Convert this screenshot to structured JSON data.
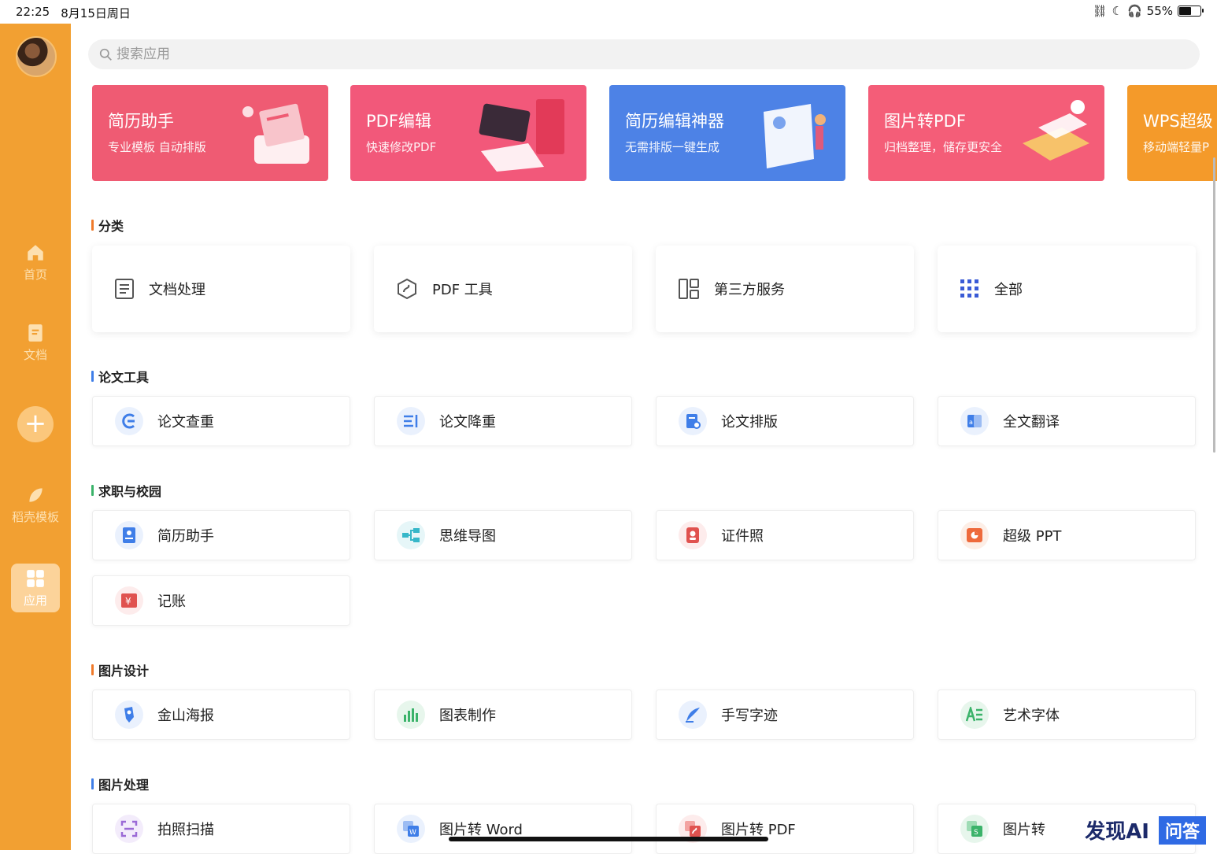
{
  "status": {
    "time": "22:25",
    "date": "8月15日周日",
    "battery": "55%",
    "battery_level": 0.55
  },
  "sidebar": {
    "items": [
      {
        "label": "首页"
      },
      {
        "label": "文档"
      },
      {
        "label": "稻壳模板"
      },
      {
        "label": "应用"
      }
    ],
    "add_label": "+"
  },
  "search": {
    "placeholder": "搜索应用"
  },
  "banners": [
    {
      "title": "简历助手",
      "subtitle": "专业模板 自动排版",
      "color": "#ef5b73"
    },
    {
      "title": "PDF编辑",
      "subtitle": "快速修改PDF",
      "color": "#f2587a"
    },
    {
      "title": "简历编辑神器",
      "subtitle": "无需排版一键生成",
      "color": "#4d82e6"
    },
    {
      "title": "图片转PDF",
      "subtitle": "归档整理，储存更安全",
      "color": "#f45d78"
    },
    {
      "title": "WPS超级",
      "subtitle": "移动端轻量P",
      "color": "#f49a2a"
    }
  ],
  "sections": {
    "category": {
      "title": "分类",
      "color": "#f07a2a",
      "items": [
        {
          "label": "文档处理"
        },
        {
          "label": "PDF 工具"
        },
        {
          "label": "第三方服务"
        },
        {
          "label": "全部"
        }
      ]
    },
    "thesis": {
      "title": "论文工具",
      "color": "#3f7ee8",
      "items": [
        {
          "label": "论文查重"
        },
        {
          "label": "论文降重"
        },
        {
          "label": "论文排版"
        },
        {
          "label": "全文翻译"
        }
      ]
    },
    "career": {
      "title": "求职与校园",
      "color": "#3bb36a",
      "items": [
        {
          "label": "简历助手"
        },
        {
          "label": "思维导图"
        },
        {
          "label": "证件照"
        },
        {
          "label": "超级 PPT"
        },
        {
          "label": "记账"
        }
      ]
    },
    "design": {
      "title": "图片设计",
      "color": "#f07a2a",
      "items": [
        {
          "label": "金山海报"
        },
        {
          "label": "图表制作"
        },
        {
          "label": "手写字迹"
        },
        {
          "label": "艺术字体"
        }
      ]
    },
    "image": {
      "title": "图片处理",
      "color": "#3f7ee8",
      "items": [
        {
          "label": "拍照扫描"
        },
        {
          "label": "图片转 Word"
        },
        {
          "label": "图片转 PDF"
        },
        {
          "label": "图片转"
        }
      ]
    }
  },
  "watermark": {
    "logo": "发现AI",
    "qa": "问答"
  }
}
